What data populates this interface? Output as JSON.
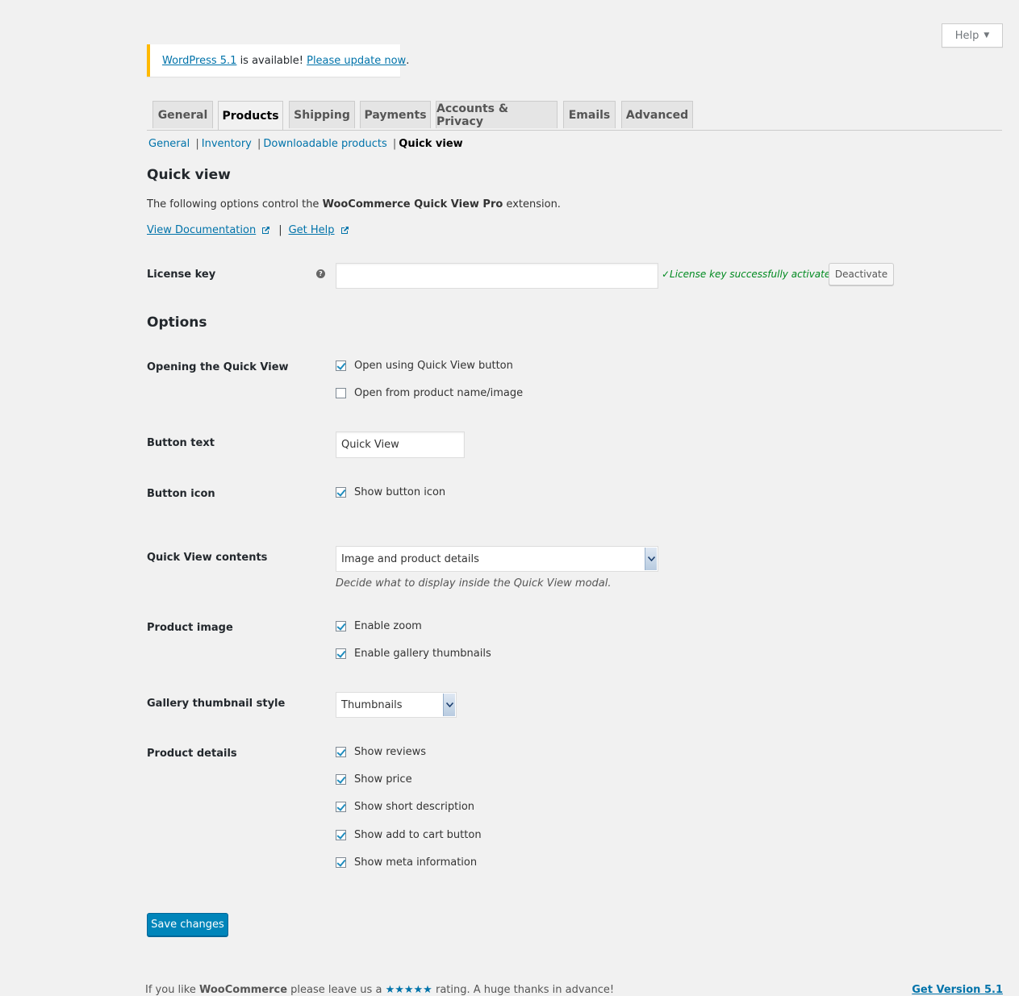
{
  "help_tab": {
    "label": "Help"
  },
  "notice": {
    "wp_version_link": "WordPress 5.1",
    "middle_text": " is available! ",
    "update_link": "Please update now",
    "end_text": "."
  },
  "tabs": [
    {
      "label": "General",
      "active": false
    },
    {
      "label": "Products",
      "active": true
    },
    {
      "label": "Shipping",
      "active": false
    },
    {
      "label": "Payments",
      "active": false
    },
    {
      "label": "Accounts & Privacy",
      "active": false
    },
    {
      "label": "Emails",
      "active": false
    },
    {
      "label": "Advanced",
      "active": false
    }
  ],
  "subnav": {
    "general": "General",
    "inventory": "Inventory",
    "downloadable": "Downloadable products",
    "quick_view": "Quick view"
  },
  "section": {
    "title": "Quick view",
    "desc_prefix": "The following options control the ",
    "desc_bold": "WooCommerce Quick View Pro",
    "desc_suffix": " extension.",
    "doc_link": "View Documentation",
    "link_sep": "|",
    "help_link": "Get Help"
  },
  "license": {
    "label": "License key",
    "help_icon": "?",
    "value": "",
    "status": "✓License key successfully activated.",
    "deactivate_button": "Deactivate"
  },
  "options": {
    "title": "Options",
    "opening": {
      "label": "Opening the Quick View",
      "opt1": {
        "label": "Open using Quick View button",
        "checked": true
      },
      "opt2": {
        "label": "Open from product name/image",
        "checked": false
      }
    },
    "button_text": {
      "label": "Button text",
      "value": "Quick View"
    },
    "button_icon": {
      "label": "Button icon",
      "opt": {
        "label": "Show button icon",
        "checked": true
      }
    },
    "contents": {
      "label": "Quick View contents",
      "selected": "Image and product details",
      "hint": "Decide what to display inside the Quick View modal."
    },
    "product_image": {
      "label": "Product image",
      "zoom": {
        "label": "Enable zoom",
        "checked": true
      },
      "gallery": {
        "label": "Enable gallery thumbnails",
        "checked": true
      }
    },
    "gallery_style": {
      "label": "Gallery thumbnail style",
      "selected": "Thumbnails"
    },
    "product_details": {
      "label": "Product details",
      "reviews": {
        "label": "Show reviews",
        "checked": true
      },
      "price": {
        "label": "Show price",
        "checked": true
      },
      "short_desc": {
        "label": "Show short description",
        "checked": true
      },
      "add_to_cart": {
        "label": "Show add to cart button",
        "checked": true
      },
      "meta": {
        "label": "Show meta information",
        "checked": true
      }
    }
  },
  "save_button": "Save changes",
  "footer": {
    "prefix": "If you like ",
    "brand": "WooCommerce",
    "middle": " please leave us a ",
    "stars": "★★★★★",
    "suffix": " rating. A huge thanks in advance!",
    "version_link": "Get Version 5.1"
  },
  "colors": {
    "accent": "#0073aa",
    "primary_button": "#0085ba",
    "notice_border": "#ffb900",
    "success": "#008a20"
  }
}
